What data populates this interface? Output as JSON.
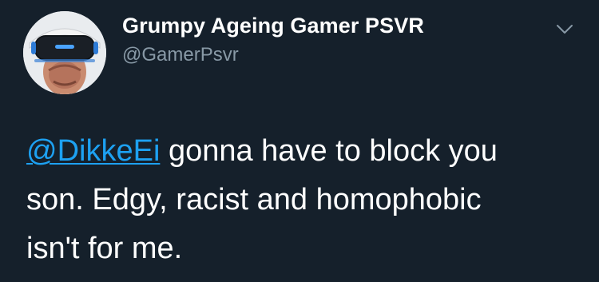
{
  "tweet": {
    "author": {
      "display_name": "Grumpy Ageing Gamer PSVR",
      "handle": "@GamerPsvr",
      "avatar_icon": "vr-headset-avatar"
    },
    "menu_icon": "chevron-down-icon",
    "text": {
      "mention": "@DikkeEi",
      "line1_rest": " gonna have to block you",
      "line2": "son. Edgy, racist and homophobic",
      "line3": "isn't for me."
    }
  },
  "colors": {
    "background": "#15202b",
    "primary_text": "#ffffff",
    "secondary_text": "#8899a6",
    "link": "#1da1f2"
  }
}
